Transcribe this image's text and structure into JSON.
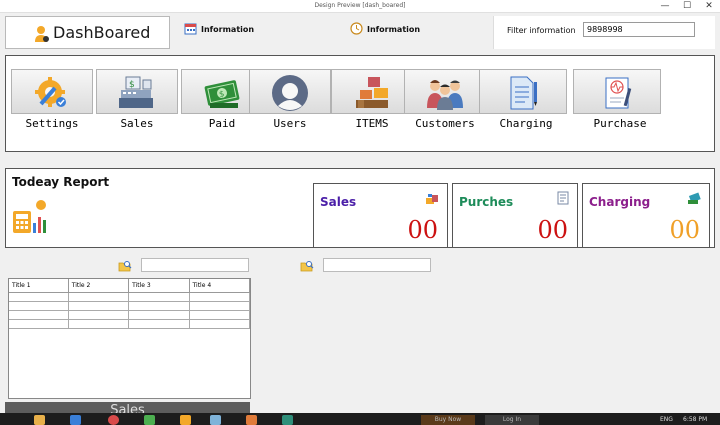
{
  "window": {
    "title": "Design Preview [dash_boared]",
    "minimize": "—",
    "maximize": "☐",
    "close": "✕"
  },
  "header": {
    "app_name": "DashBoared",
    "info1_label": "Information",
    "info2_label": "Information",
    "filter_label": "Filter information",
    "filter_value": "9898998"
  },
  "menu": [
    {
      "label": "Settings",
      "icon": "settings-gear-icon"
    },
    {
      "label": "Sales",
      "icon": "cash-register-icon"
    },
    {
      "label": "Paid",
      "icon": "money-bill-icon"
    },
    {
      "label": "Users",
      "icon": "user-silhouette-icon"
    },
    {
      "label": "ITEMS",
      "icon": "boxes-icon"
    },
    {
      "label": "Customers",
      "icon": "people-group-icon"
    },
    {
      "label": "Charging",
      "icon": "document-charging-icon"
    },
    {
      "label": "Purchase",
      "icon": "purchase-receipt-icon"
    }
  ],
  "report": {
    "heading": "Todeay Report",
    "cards": [
      {
        "name": "Sales",
        "value": "00",
        "name_color": "#4b1fa8",
        "value_color": "#cc1111"
      },
      {
        "name": "Purches",
        "value": "00",
        "name_color": "#1e8c5a",
        "value_color": "#cc1111"
      },
      {
        "name": "Charging",
        "value": "00",
        "name_color": "#8c1f8c",
        "value_color": "#f0a028"
      }
    ]
  },
  "search": {
    "left_value": "",
    "right_value": ""
  },
  "table": {
    "columns": [
      "Title 1",
      "Title 2",
      "Title 3",
      "Title 4"
    ]
  },
  "bottom_button": {
    "label": "Sales"
  },
  "taskbar": {
    "item1": "Buy Now",
    "item2": "Log In",
    "lang": "ENG",
    "time": "6:58 PM"
  },
  "colors": {
    "panel_border": "#555555",
    "sales_name": "#4b1fa8",
    "purches_name": "#1e8c5a",
    "charging_name": "#8c1f8c",
    "value_red": "#cc1111",
    "value_orange": "#f0a028"
  }
}
